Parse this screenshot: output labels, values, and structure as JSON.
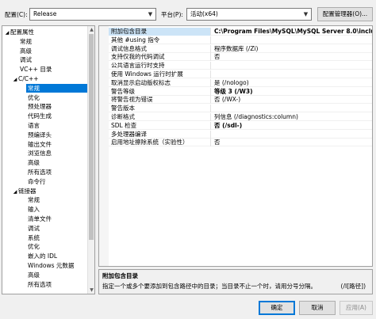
{
  "toolbar": {
    "config_label": "配置(C):",
    "config_value": "Release",
    "platform_label": "平台(P):",
    "platform_value": "活动(x64)",
    "config_manager_label": "配置管理器(O)..."
  },
  "tree": {
    "items": [
      {
        "label": "配置属性",
        "expander": "◢",
        "indent": 0
      },
      {
        "label": "常规",
        "indent": 2
      },
      {
        "label": "高级",
        "indent": 2
      },
      {
        "label": "调试",
        "indent": 2
      },
      {
        "label": "VC++ 目录",
        "indent": 2
      },
      {
        "label": "C/C++",
        "expander": "◢",
        "indent": 1
      },
      {
        "label": "常规",
        "indent": 3,
        "selected": true
      },
      {
        "label": "优化",
        "indent": 3
      },
      {
        "label": "预处理器",
        "indent": 3
      },
      {
        "label": "代码生成",
        "indent": 3
      },
      {
        "label": "语言",
        "indent": 3
      },
      {
        "label": "预编译头",
        "indent": 3
      },
      {
        "label": "输出文件",
        "indent": 3
      },
      {
        "label": "浏览信息",
        "indent": 3
      },
      {
        "label": "高级",
        "indent": 3
      },
      {
        "label": "所有选项",
        "indent": 3
      },
      {
        "label": "命令行",
        "indent": 3
      },
      {
        "label": "链接器",
        "expander": "◢",
        "indent": 1
      },
      {
        "label": "常规",
        "indent": 3
      },
      {
        "label": "输入",
        "indent": 3
      },
      {
        "label": "清单文件",
        "indent": 3
      },
      {
        "label": "调试",
        "indent": 3
      },
      {
        "label": "系统",
        "indent": 3
      },
      {
        "label": "优化",
        "indent": 3
      },
      {
        "label": "嵌入的 IDL",
        "indent": 3
      },
      {
        "label": "Windows 元数据",
        "indent": 3
      },
      {
        "label": "高级",
        "indent": 3
      },
      {
        "label": "所有选项",
        "indent": 3
      }
    ]
  },
  "properties": [
    {
      "name": "附加包含目录",
      "value": "C:\\Program Files\\MySQL\\MySQL Server 8.0\\include;%",
      "bold": true,
      "selected": true
    },
    {
      "name": "其他 #using 指令",
      "value": ""
    },
    {
      "name": "调试信息格式",
      "value": "程序数据库 (/Zi)"
    },
    {
      "name": "支持仅我的代码调试",
      "value": "否"
    },
    {
      "name": "公共语言运行时支持",
      "value": ""
    },
    {
      "name": "使用 Windows 运行时扩展",
      "value": ""
    },
    {
      "name": "取消显示启动版权标志",
      "value": "是 (/nologo)"
    },
    {
      "name": "警告等级",
      "value": "等级 3 (/W3)",
      "bold": true
    },
    {
      "name": "将警告视为错误",
      "value": "否 (/WX-)"
    },
    {
      "name": "警告版本",
      "value": ""
    },
    {
      "name": "诊断格式",
      "value": "列信息 (/diagnostics:column)"
    },
    {
      "name": "SDL 检查",
      "value": "否 (/sdl-)",
      "bold": true
    },
    {
      "name": "多处理器编译",
      "value": ""
    },
    {
      "name": "启用地址擦除系统（实验性）",
      "value": "否"
    }
  ],
  "description": {
    "title": "附加包含目录",
    "text": "指定一个或多个要添加到包含路径中的目录；当目录不止一个时，请用分号分隔。",
    "switch": "(/I[路径])"
  },
  "buttons": {
    "ok": "确定",
    "cancel": "取消",
    "apply": "应用(A)"
  }
}
